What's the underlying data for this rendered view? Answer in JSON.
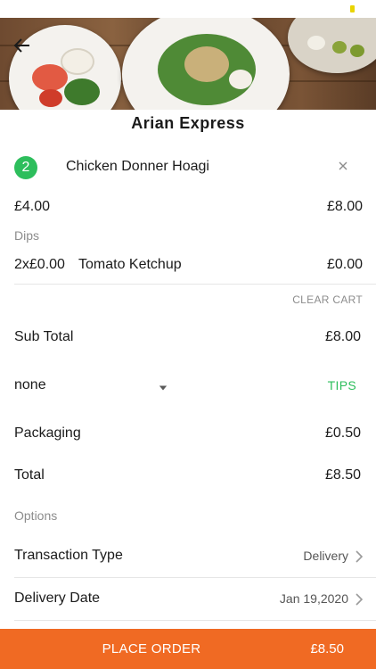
{
  "store": {
    "name": "Arian Express"
  },
  "cart_item": {
    "quantity": "2",
    "name": "Chicken Donner Hoagi",
    "unit_price": "£4.00",
    "line_total": "£8.00",
    "dips_label": "Dips",
    "dip": {
      "qty_price": "2x£0.00",
      "name": "Tomato Ketchup",
      "price": "£0.00"
    }
  },
  "actions": {
    "clear_cart": "CLEAR CART",
    "tips": "TIPS"
  },
  "summary": {
    "subtotal_label": "Sub Total",
    "subtotal": "£8.00",
    "tip_selected": "none",
    "packaging_label": "Packaging",
    "packaging": "£0.50",
    "total_label": "Total",
    "total": "£8.50"
  },
  "options": {
    "heading": "Options",
    "transaction_type_label": "Transaction Type",
    "transaction_type": "Delivery",
    "delivery_date_label": "Delivery Date",
    "delivery_date": "Jan 19,2020"
  },
  "footer": {
    "place_order": "PLACE ORDER",
    "amount": "£8.50"
  },
  "colors": {
    "accent_green": "#2dbe5c",
    "order_orange": "#f06a23"
  },
  "icons": {
    "back": "arrow-left-icon",
    "remove": "close-icon",
    "dropdown": "caret-down-icon",
    "row": "chevron-right-icon"
  }
}
